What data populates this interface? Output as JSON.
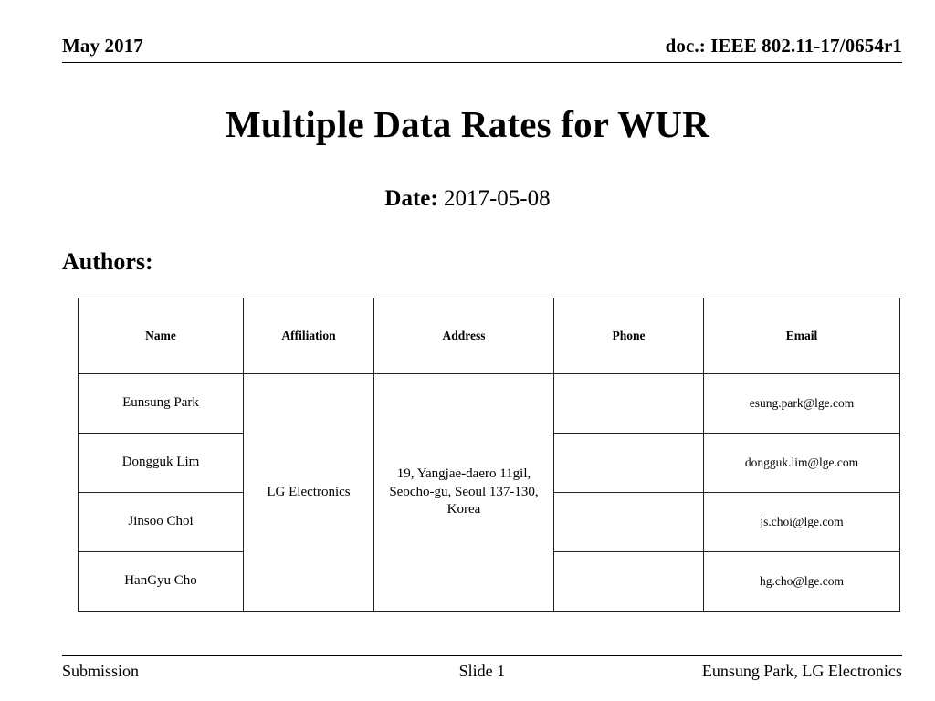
{
  "header": {
    "date": "May 2017",
    "doc_id": "doc.: IEEE 802.11-17/0654r1"
  },
  "title": "Multiple Data Rates for WUR",
  "date_line": {
    "label": "Date:",
    "value": "2017-05-08"
  },
  "authors_section": {
    "label": "Authors:"
  },
  "table": {
    "columns": [
      "Name",
      "Affiliation",
      "Address",
      "Phone",
      "Email"
    ],
    "shared": {
      "affiliation": "LG Electronics",
      "address": "19, Yangjae-daero 11gil, Seocho-gu, Seoul 137-130, Korea"
    },
    "rows": [
      {
        "name": "Eunsung Park",
        "phone": "",
        "email": "esung.park@lge.com"
      },
      {
        "name": "Dongguk Lim",
        "phone": "",
        "email": "dongguk.lim@lge.com"
      },
      {
        "name": "Jinsoo Choi",
        "phone": "",
        "email": "js.choi@lge.com"
      },
      {
        "name": "HanGyu Cho",
        "phone": "",
        "email": "hg.cho@lge.com"
      }
    ]
  },
  "footer": {
    "left": "Submission",
    "center": "Slide 1",
    "right": "Eunsung Park, LG Electronics"
  }
}
